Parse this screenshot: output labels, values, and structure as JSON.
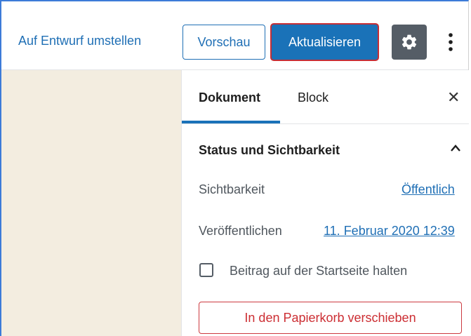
{
  "header": {
    "switch_to_draft": "Auf Entwurf umstellen",
    "preview_label": "Vorschau",
    "update_label": "Aktualisieren",
    "settings_icon": "gear-icon",
    "more_icon": "vertical-ellipsis-icon"
  },
  "sidebar": {
    "tabs": [
      {
        "label": "Dokument",
        "active": true
      },
      {
        "label": "Block",
        "active": false
      }
    ],
    "close_icon": "close-icon",
    "panel": {
      "title": "Status und Sichtbarkeit",
      "expanded": true,
      "visibility_label": "Sichtbarkeit",
      "visibility_value": "Öffentlich",
      "publish_label": "Veröffentlichen",
      "publish_value": "11. Februar 2020 12:39",
      "sticky_label": "Beitrag auf der Startseite halten",
      "sticky_checked": false,
      "trash_label": "In den Papierkorb verschieben"
    }
  },
  "colors": {
    "accent": "#1a72b8",
    "link": "#1f6fb5",
    "danger": "#cc2e33",
    "canvas": "#f3ede0",
    "settings_bg": "#555d66"
  }
}
